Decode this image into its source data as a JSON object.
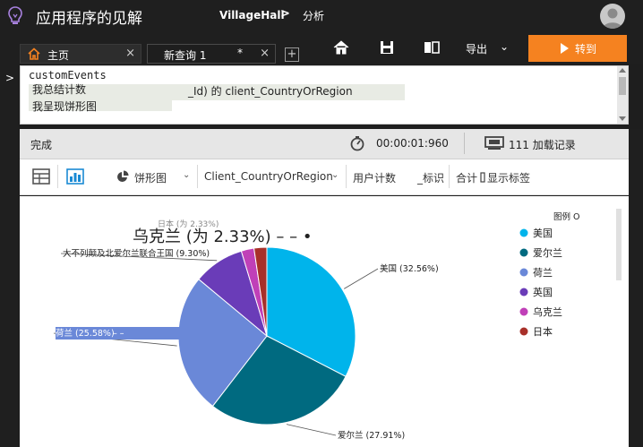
{
  "app": {
    "title": "应用程序的见解"
  },
  "breadcrumb": {
    "resource": "VillageHall",
    "separator": ">",
    "page": "分析"
  },
  "tabs": [
    {
      "label": "主页",
      "close": "×"
    },
    {
      "label": "新查询 1",
      "dirty": "*",
      "close": "×"
    }
  ],
  "new_tab": "+",
  "toolbar_top": {
    "export_label": "导出",
    "export_chevron": "⌄",
    "run_label": "转到"
  },
  "sidebar": {
    "expand_glyph": ">"
  },
  "editor": {
    "line1": "customEvents",
    "line2_a": "我总结计数",
    "line2_b": "_Id) 的 client_CountryOrRegion",
    "line3": "我呈现饼形图"
  },
  "status": {
    "state": "完成",
    "elapsed": "00:00:01:960",
    "records": "111 加载记录"
  },
  "results_toolbar": {
    "chart_type": "饼形图",
    "column": "Client_CountryOrRegion",
    "field_1": "用户计数",
    "field_2": "_标识",
    "field_3": "合计",
    "show_labels": "显示标签"
  },
  "chart_data": {
    "type": "pie",
    "slices": [
      {
        "name": "美国",
        "value": 32.56,
        "color": "#00b4eb",
        "label": "美国 (32.56%)"
      },
      {
        "name": "爱尔兰",
        "value": 27.91,
        "color": "#006a80",
        "label": "爱尔兰 (27.91%)"
      },
      {
        "name": "荷兰",
        "value": 25.58,
        "color": "#6a88d8",
        "label": "荷兰 (25.58%)"
      },
      {
        "name": "英国",
        "value": 9.3,
        "color": "#6a3cb8",
        "label": "大不列颠及北爱尔兰联合王国 (9.30%)"
      },
      {
        "name": "乌克兰",
        "value": 2.33,
        "color": "#c040b8",
        "label": "乌克兰 (为 2.33%)"
      },
      {
        "name": "日本",
        "value": 2.33,
        "color": "#a8302a",
        "label": "日本 (为 2.33%)"
      }
    ],
    "legend_title": "图例 O",
    "legend_placement": "top-right",
    "tooltip": "乌克兰 (为 2.33%) – –  •",
    "label_dash": "– –"
  },
  "colors": {
    "accent": "#f58220",
    "chrome": "#1f1f1f"
  }
}
